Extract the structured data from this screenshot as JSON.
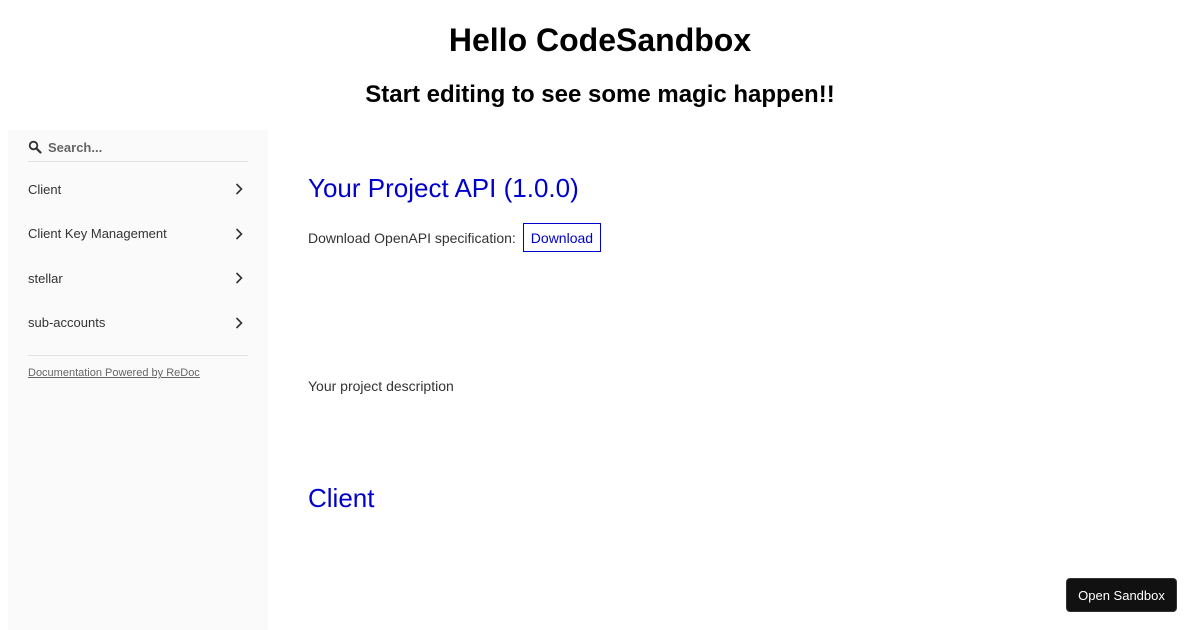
{
  "header": {
    "title": "Hello CodeSandbox",
    "subtitle": "Start editing to see some magic happen!!"
  },
  "sidebar": {
    "search": {
      "placeholder": "Search...",
      "icon": "search-icon"
    },
    "items": [
      {
        "label": "Client",
        "icon": "chevron-right-icon"
      },
      {
        "label": "Client Key Management",
        "icon": "chevron-right-icon"
      },
      {
        "label": "stellar",
        "icon": "chevron-right-icon"
      },
      {
        "label": "sub-accounts",
        "icon": "chevron-right-icon"
      }
    ],
    "powered_by": "Documentation Powered by ReDoc"
  },
  "content": {
    "api_title": "Your Project API (1.0.0)",
    "download_label": "Download OpenAPI specification:",
    "download_button": "Download",
    "description": "Your project description",
    "section_title": "Client"
  },
  "sandbox_button": "Open Sandbox",
  "colors": {
    "link": "#0000cc",
    "sidebar_bg": "#fafafa",
    "text": "#333333",
    "sandbox_bg": "#111111"
  }
}
